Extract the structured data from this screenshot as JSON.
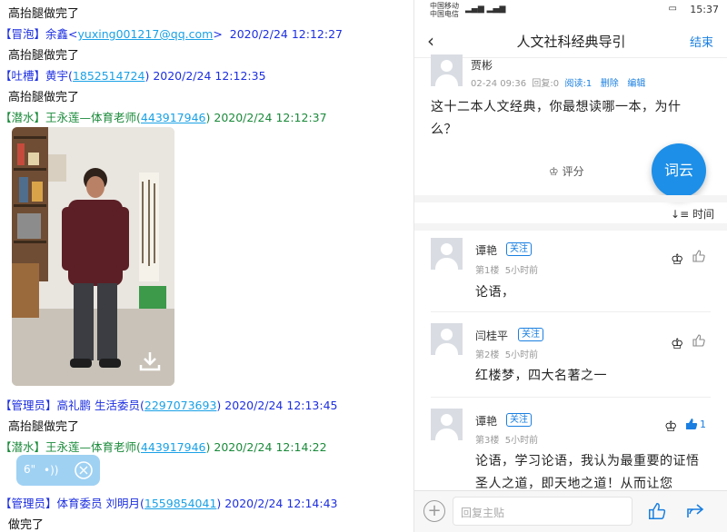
{
  "chat": {
    "messages": [
      {
        "text": "高抬腿做完了"
      },
      {
        "tag": "【冒泡】",
        "name": "余鑫",
        "email": "yuxing001217@qq.com",
        "time": "2020/2/24 12:12:27",
        "text": "高抬腿做完了"
      },
      {
        "tag": "【吐槽】",
        "name": "黄宇",
        "qq": "1852514724",
        "time": "2020/2/24 12:12:35",
        "text": "高抬腿做完了"
      },
      {
        "tag": "【潜水】",
        "name": "王永莲—体育老师",
        "qq": "443917946",
        "time": "2020/2/24 12:12:37"
      },
      {
        "tag": "【管理员】",
        "name": "高礼鹏  生活委员",
        "qq": "2297073693",
        "time": "2020/2/24 12:13:45",
        "text": "高抬腿做完了"
      },
      {
        "tag": "【潜水】",
        "name": "王永莲—体育老师",
        "qq": "443917946",
        "time": "2020/2/24 12:14:22",
        "voice_seconds": "6\""
      },
      {
        "tag": "【管理员】",
        "name": "体育委员  刘明月",
        "qq": "1559854041",
        "time": "2020/2/24 12:14:43",
        "text": "做完了"
      }
    ]
  },
  "app": {
    "status": {
      "carrier1": "中国移动",
      "carrier2": "中国电信",
      "time": "15:37"
    },
    "nav": {
      "title": "人文社科经典导引",
      "done": "结束"
    },
    "post": {
      "author": "贾彬",
      "date": "02-24 09:36",
      "reply": "回复:0",
      "read": "阅读:1",
      "delete": "删除",
      "edit": "编辑",
      "question": "这十二本人文经典，你最想读哪一本，为什么？",
      "rate": "评分"
    },
    "fab": "词云",
    "sort": "时间",
    "comments": [
      {
        "name": "谭艳",
        "follow": "关注",
        "floor": "第1楼",
        "ago": "5小时前",
        "text": "论语，",
        "likes": ""
      },
      {
        "name": "闫桂平",
        "follow": "关注",
        "floor": "第2楼",
        "ago": "5小时前",
        "text": "红楼梦，四大名著之一",
        "likes": ""
      },
      {
        "name": "谭艳",
        "follow": "关注",
        "floor": "第3楼",
        "ago": "5小时前",
        "text": "论语，学习论语，我认为最重要的证悟圣人之道，即天地之道！从而让您",
        "likes": "1"
      }
    ],
    "reply_placeholder": "回复主贴"
  }
}
